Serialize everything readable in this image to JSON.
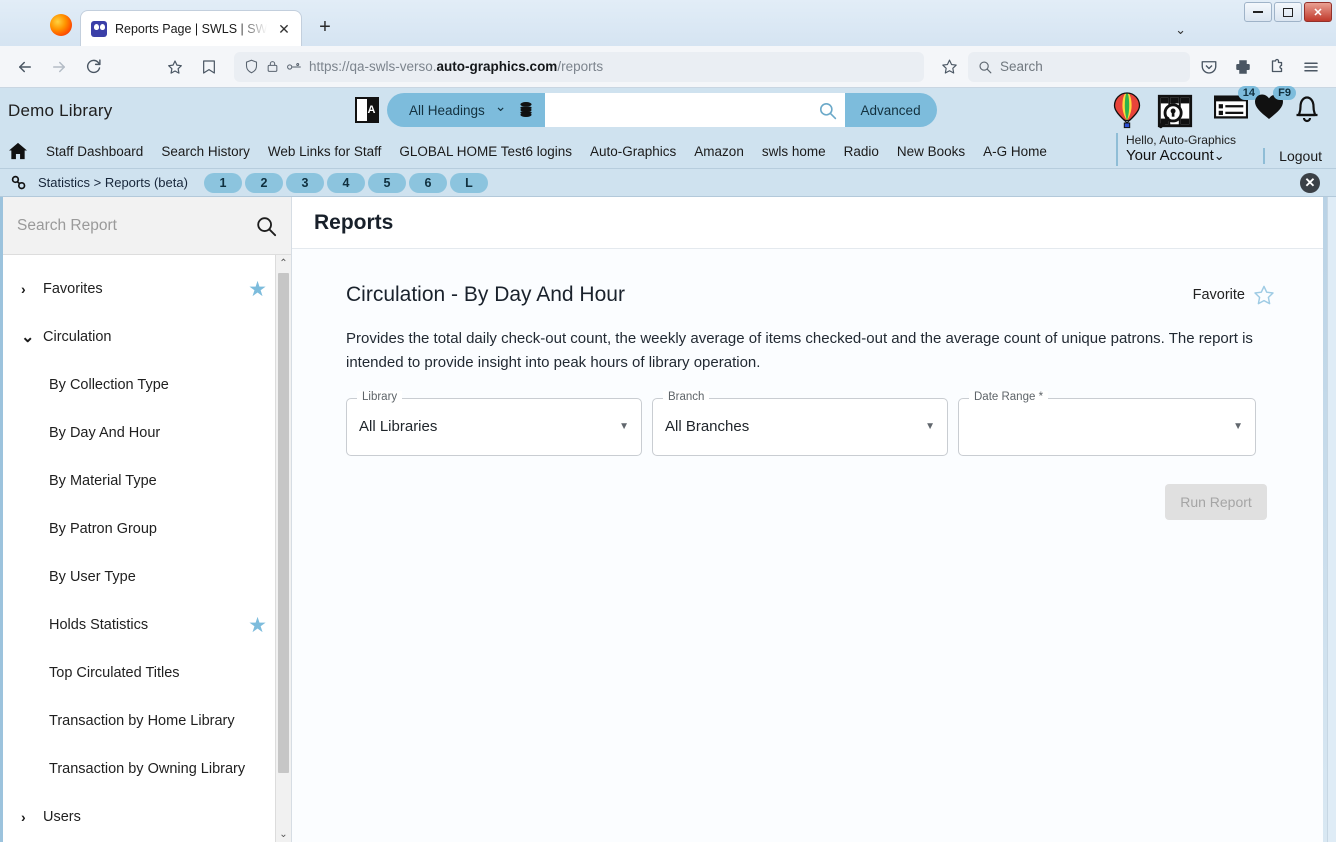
{
  "browser": {
    "tab": {
      "title": "Reports Page | SWLS | SWLS | Au",
      "close_glyph": "✕"
    },
    "newtab_glyph": "+",
    "tablist_chevron": "⌄",
    "window_controls": {
      "minimize": "minimize",
      "maximize": "maximize",
      "close": "✕"
    },
    "url_prefix": "https://qa-swls-verso.",
    "url_domain": "auto-graphics.com",
    "url_path": "/reports",
    "search_placeholder": "Search",
    "icons": {
      "back": "back-arrow-icon",
      "forward": "forward-arrow-icon",
      "reload": "reload-icon",
      "bookmark": "bookmark-star-icon",
      "save_to_pocket_url": "save-page-icon",
      "shield": "shield-icon",
      "lock": "padlock-icon",
      "permissions": "permissions-icon",
      "star": "star-icon",
      "pocket": "pocket-icon",
      "print": "print-icon",
      "extensions": "extensions-icon",
      "menu": "hamburger-menu-icon"
    }
  },
  "app_header": {
    "library_name": "Demo Library",
    "language_icon": "A",
    "search_scope": "All Headings",
    "search_scope_caret": "⌄",
    "search_value": "",
    "advanced_label": "Advanced",
    "nav_links": [
      "Staff Dashboard",
      "Search History",
      "Web Links for Staff",
      "GLOBAL HOME Test6 logins",
      "Auto-Graphics",
      "Amazon",
      "swls home",
      "Radio",
      "New Books",
      "A-G Home"
    ],
    "account_hello": "Hello, Auto-Graphics",
    "account_name": "Your Account",
    "account_caret": "⌄",
    "logout": "Logout",
    "list_badge": "14",
    "heart_badge": "F9",
    "accent_color": "#7dbcdc",
    "header_bg": "#cfe2ef"
  },
  "breadcrumb": {
    "path": "Statistics > Reports (beta)",
    "pills": [
      "1",
      "2",
      "3",
      "4",
      "5",
      "6",
      "L"
    ],
    "close_glyph": "✕"
  },
  "sidebar": {
    "search_placeholder": "Search Report",
    "items": [
      {
        "label": "Favorites",
        "level": 0,
        "chevron": "›",
        "starred": true
      },
      {
        "label": "Circulation",
        "level": 0,
        "chevron": "⌄",
        "starred": false
      },
      {
        "label": "By Collection Type",
        "level": 1,
        "chevron": "",
        "starred": false
      },
      {
        "label": "By Day And Hour",
        "level": 1,
        "chevron": "",
        "starred": false
      },
      {
        "label": "By Material Type",
        "level": 1,
        "chevron": "",
        "starred": false
      },
      {
        "label": "By Patron Group",
        "level": 1,
        "chevron": "",
        "starred": false
      },
      {
        "label": "By User Type",
        "level": 1,
        "chevron": "",
        "starred": false
      },
      {
        "label": "Holds Statistics",
        "level": 1,
        "chevron": "",
        "starred": true
      },
      {
        "label": "Top Circulated Titles",
        "level": 1,
        "chevron": "",
        "starred": false
      },
      {
        "label": "Transaction by Home Library",
        "level": 1,
        "chevron": "",
        "starred": false
      },
      {
        "label": "Transaction by Owning Library",
        "level": 1,
        "chevron": "",
        "starred": false
      },
      {
        "label": "Users",
        "level": 0,
        "chevron": "›",
        "starred": false
      }
    ],
    "scroll_up_glyph": "⌃",
    "scroll_down_glyph": "⌄"
  },
  "main": {
    "page_title": "Reports",
    "report_title": "Circulation - By Day And Hour",
    "favorite_label": "Favorite",
    "favorite_star": "☆",
    "description": "Provides the total daily check-out count, the weekly average of items checked-out and the average count of unique patrons. The report is intended to provide insight into peak hours of library operation.",
    "fields": [
      {
        "label": "Library",
        "value": "All Libraries",
        "caret": "▼"
      },
      {
        "label": "Branch",
        "value": "All Branches",
        "caret": "▼"
      },
      {
        "label": "Date Range *",
        "value": "",
        "caret": "▼"
      }
    ],
    "run_button": "Run Report"
  }
}
